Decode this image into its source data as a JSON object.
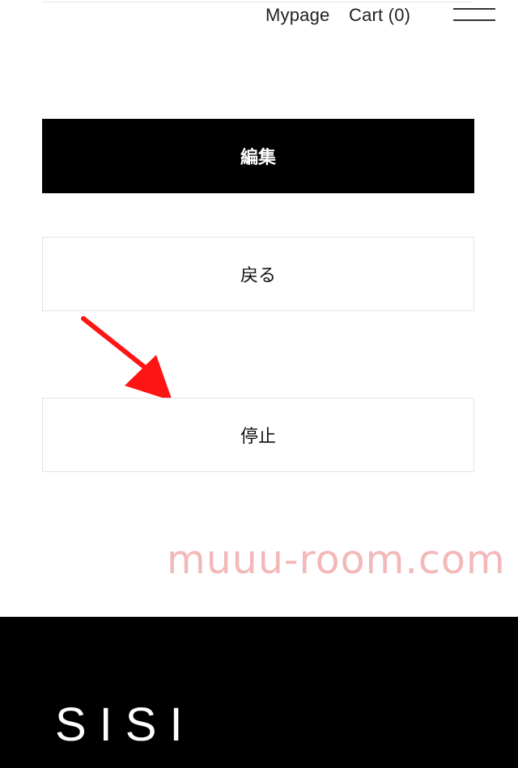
{
  "header": {
    "mypage_label": "Mypage",
    "cart_label": "Cart (0)",
    "menu_icon": "hamburger-menu-icon"
  },
  "actions": {
    "edit_label": "編集",
    "back_label": "戻る",
    "stop_label": "停止"
  },
  "annotation": {
    "arrow_icon": "red-arrow-icon",
    "arrow_color": "#ff1414"
  },
  "watermark": {
    "text": "muuu-room.com",
    "color": "#f3b8b8"
  },
  "footer": {
    "logo_text": "SISI"
  },
  "colors": {
    "primary_button": "#000000",
    "footer_background": "#000000"
  }
}
